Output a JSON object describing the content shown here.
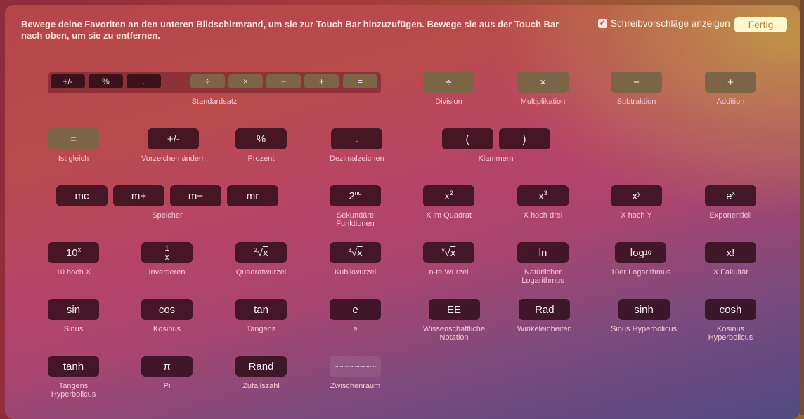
{
  "header": {
    "instruction": "Bewege deine Favoriten an den unteren Bildschirmrand, um sie zur Touch Bar hinzuzufügen. Bewege sie aus der Touch Bar nach oben, um sie zu entfernen.",
    "suggestions_label": "Schreibvorschläge anzeigen",
    "suggestions_checked": true,
    "checkmark": "✓",
    "done_label": "Fertig"
  },
  "standard_set": {
    "label": "Standardsatz",
    "keys": [
      "+/-",
      "%",
      ".",
      "÷",
      "×",
      "−",
      "+",
      "="
    ]
  },
  "items": {
    "division": {
      "key": "÷",
      "label": "Division"
    },
    "multiplication": {
      "key": "×",
      "label": "Multiplikation"
    },
    "subtraction": {
      "key": "−",
      "label": "Subtraktion"
    },
    "addition": {
      "key": "+",
      "label": "Addition"
    },
    "equals": {
      "key": "=",
      "label": "Ist gleich"
    },
    "sign": {
      "key": "+/-",
      "label": "Vorzeichen ändern"
    },
    "percent": {
      "key": "%",
      "label": "Prozent"
    },
    "decimal": {
      "key": ".",
      "label": "Dezimalzeichen"
    },
    "brackets": {
      "open": "(",
      "close": ")",
      "label": "Klammern"
    },
    "memory": {
      "keys": [
        "mc",
        "m+",
        "m−",
        "mr"
      ],
      "label": "Speicher"
    },
    "second": {
      "base": "2",
      "sup": "nd",
      "label": "Sekundäre\nFunktionen"
    },
    "x_squared": {
      "base": "x",
      "sup": "2",
      "label": "X im Quadrat"
    },
    "x_cubed": {
      "base": "x",
      "sup": "3",
      "label": "X hoch drei"
    },
    "x_power_y": {
      "base": "x",
      "sup": "y",
      "label": "X hoch Y"
    },
    "exp": {
      "base": "e",
      "sup": "x",
      "label": "Exponentiell"
    },
    "ten_power_x": {
      "base": "10",
      "sup": "x",
      "label": "10 hoch X"
    },
    "invert": {
      "num": "1",
      "den": "x",
      "label": "Invertieren"
    },
    "sqrt": {
      "idx": "2",
      "rad": "x",
      "label": "Quadratwurzel"
    },
    "cbrt": {
      "idx": "3",
      "rad": "x",
      "label": "Kubikwurzel"
    },
    "nth_root": {
      "idx": "y",
      "rad": "x",
      "label": "n-te Wurzel"
    },
    "ln": {
      "key": "ln",
      "label": "Natürlicher\nLogarithmus"
    },
    "log10": {
      "base": "log",
      "sub": "10",
      "label": "10er Logarithmus"
    },
    "factorial": {
      "key": "x!",
      "label": "X Fakultät"
    },
    "sin": {
      "key": "sin",
      "label": "Sinus"
    },
    "cos": {
      "key": "cos",
      "label": "Kosinus"
    },
    "tan": {
      "key": "tan",
      "label": "Tangens"
    },
    "e": {
      "key": "e",
      "label": "e"
    },
    "ee": {
      "key": "EE",
      "label": "Wissenschaftliche\nNotation"
    },
    "rad": {
      "key": "Rad",
      "label": "Winkeleinheiten"
    },
    "sinh": {
      "key": "sinh",
      "label": "Sinus Hyperbolicus"
    },
    "cosh": {
      "key": "cosh",
      "label": "Kosinus\nHyperbolicus"
    },
    "tanh": {
      "key": "tanh",
      "label": "Tangens\nHyperbolicus"
    },
    "pi": {
      "key": "π",
      "label": "Pi"
    },
    "rand": {
      "key": "Rand",
      "label": "Zufallszahl"
    },
    "space": {
      "key": "·························",
      "label": "Zwischenraum"
    }
  }
}
